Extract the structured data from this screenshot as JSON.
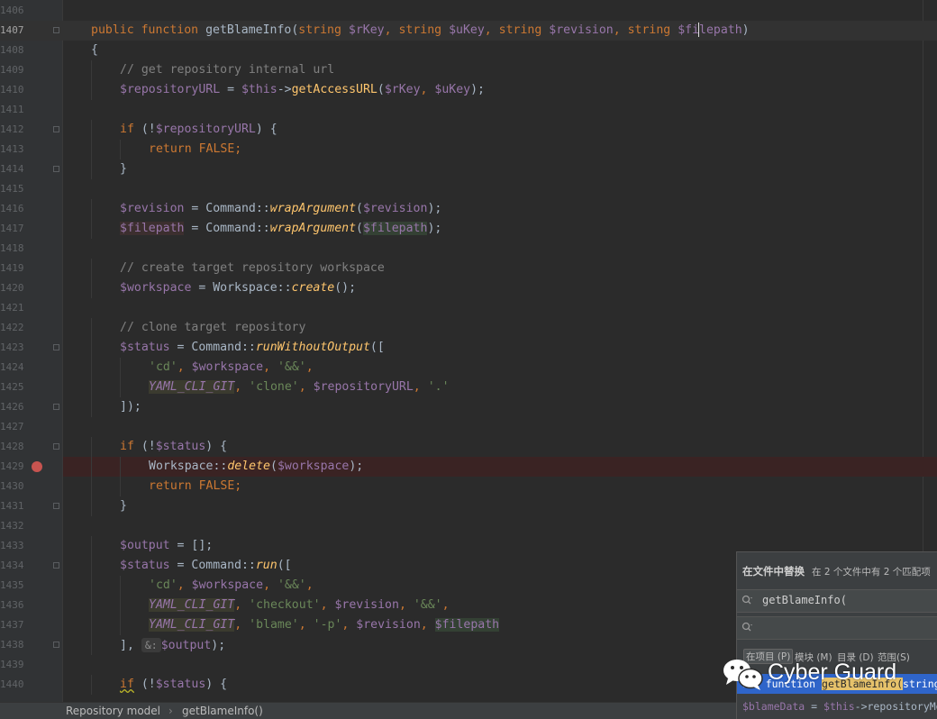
{
  "colors": {
    "background": "#2b2b2b",
    "keyword": "#cc7832",
    "function": "#ffc66d",
    "variable": "#9876aa",
    "string": "#6a8759",
    "comment": "#808080",
    "breakpoint": "#c75450"
  },
  "editor": {
    "lines": {
      "l1406": "1406",
      "l1407": "1407",
      "l1408": "1408",
      "l1409": "1409",
      "l1410": "1410",
      "l1411": "1411",
      "l1412": "1412",
      "l1413": "1413",
      "l1414": "1414",
      "l1415": "1415",
      "l1416": "1416",
      "l1417": "1417",
      "l1418": "1418",
      "l1419": "1419",
      "l1420": "1420",
      "l1421": "1421",
      "l1422": "1422",
      "l1423": "1423",
      "l1424": "1424",
      "l1425": "1425",
      "l1426": "1426",
      "l1427": "1427",
      "l1428": "1428",
      "l1429": "1429",
      "l1430": "1430",
      "l1431": "1431",
      "l1432": "1432",
      "l1433": "1433",
      "l1434": "1434",
      "l1435": "1435",
      "l1436": "1436",
      "l1437": "1437",
      "l1438": "1438",
      "l1439": "1439",
      "l1440": "1440"
    },
    "code": {
      "c1407": {
        "t1": "public",
        "t2": " ",
        "t3": "function",
        "t4": " getBlameInfo(",
        "t5": "string",
        "t6": " ",
        "t7": "$rKey",
        "t8": ", ",
        "t9": "string",
        "t10": " ",
        "t11": "$uKey",
        "t12": ", ",
        "t13": "string",
        "t14": " ",
        "t15": "$revision",
        "t16": ", ",
        "t17": "string",
        "t18": " ",
        "t19": "$fi",
        "t20": "lepath",
        "t21": ")"
      },
      "c1408": "{",
      "c1409": "// get repository internal url",
      "c1410": {
        "t1": "$repositoryURL",
        "t2": " = ",
        "t3": "$this",
        "t4": "->",
        "t5": "getAccessURL",
        "t6": "(",
        "t7": "$rKey",
        "t8": ", ",
        "t9": "$uKey",
        "t10": ");"
      },
      "c1412": {
        "t1": "if",
        "t2": " (!",
        "t3": "$repositoryURL",
        "t4": ") {"
      },
      "c1413": {
        "t1": "return",
        "t2": " ",
        "t3": "FALSE",
        "t4": ";"
      },
      "c1414": "}",
      "c1416": {
        "t1": "$revision",
        "t2": " = Command::",
        "t3": "wrapArgument",
        "t4": "(",
        "t5": "$revision",
        "t6": ");"
      },
      "c1417": {
        "t1": "$filepath",
        "t2": " = Command::",
        "t3": "wrapArgument",
        "t4": "(",
        "t5": "$filepath",
        "t6": ");"
      },
      "c1419": "// create target repository workspace",
      "c1420": {
        "t1": "$workspace",
        "t2": " = Workspace::",
        "t3": "create",
        "t4": "();"
      },
      "c1422": "// clone target repository",
      "c1423": {
        "t1": "$status",
        "t2": " = Command::",
        "t3": "runWithoutOutput",
        "t4": "(["
      },
      "c1424": {
        "t1": "'cd'",
        "t2": ", ",
        "t3": "$workspace",
        "t4": ", ",
        "t5": "'&&'",
        "t6": ","
      },
      "c1425": {
        "t1": "YAML_CLI_GIT",
        "t2": ", ",
        "t3": "'clone'",
        "t4": ", ",
        "t5": "$repositoryURL",
        "t6": ", ",
        "t7": "'.'"
      },
      "c1426": "]);",
      "c1428": {
        "t1": "if",
        "t2": " (!",
        "t3": "$status",
        "t4": ") {"
      },
      "c1429": {
        "t1": "Workspace::",
        "t2": "delete",
        "t3": "(",
        "t4": "$workspace",
        "t5": ");"
      },
      "c1430": {
        "t1": "return",
        "t2": " ",
        "t3": "FALSE",
        "t4": ";"
      },
      "c1431": "}",
      "c1433": {
        "t1": "$output",
        "t2": " = [];"
      },
      "c1434": {
        "t1": "$status",
        "t2": " = Command::",
        "t3": "run",
        "t4": "(["
      },
      "c1435": {
        "t1": "'cd'",
        "t2": ", ",
        "t3": "$workspace",
        "t4": ", ",
        "t5": "'&&'",
        "t6": ","
      },
      "c1436": {
        "t1": "YAML_CLI_GIT",
        "t2": ", ",
        "t3": "'checkout'",
        "t4": ", ",
        "t5": "$revision",
        "t6": ", ",
        "t7": "'&&'",
        "t8": ","
      },
      "c1437": {
        "t1": "YAML_CLI_GIT",
        "t2": ", ",
        "t3": "'blame'",
        "t4": ", ",
        "t5": "'-p'",
        "t6": ", ",
        "t7": "$revision",
        "t8": ", ",
        "t9": "$filepath"
      },
      "c1438": {
        "t1": "],",
        "t2": "&:",
        "t3": "$output",
        "t4": ");"
      },
      "c1440": {
        "t1": "if",
        "t2": " (!",
        "t3": "$status",
        "t4": ") {"
      }
    }
  },
  "breadcrumb": {
    "item1": "Repository model",
    "separator": "›",
    "item2": "getBlameInfo()"
  },
  "find_popup": {
    "title": "在文件中替换",
    "summary": "在 2 个文件中有 2 个匹配项",
    "search_value": "getBlameInfo(",
    "replace_value": "",
    "scopes": {
      "project": "在项目 (P)",
      "module": "模块 (M)",
      "directory": "目录 (D)",
      "scope": "范围(S)"
    },
    "results": {
      "r1_prefix": "lic function ",
      "r1_match": "getBlameInfo(",
      "r1_suffix": "string $",
      "r2_var": "$blameData",
      "r2_mid": " = ",
      "r2_this": "$this",
      "r2_rest": "->repositoryMod"
    }
  },
  "watermark": {
    "text": "Cyber Guard"
  }
}
